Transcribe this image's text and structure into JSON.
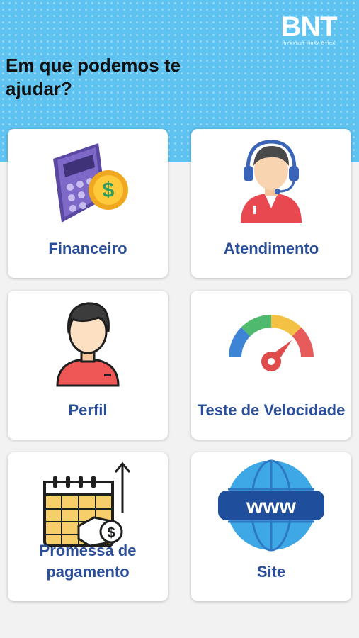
{
  "brand": {
    "logo": "BNT",
    "tagline": "INTERNET FIBRA ÓTICA"
  },
  "headline": "Em que podemos te ajudar?",
  "cards": [
    {
      "label": "Financeiro",
      "icon": "calculator-money-icon"
    },
    {
      "label": "Atendimento",
      "icon": "headset-agent-icon"
    },
    {
      "label": "Perfil",
      "icon": "user-profile-icon"
    },
    {
      "label": "Teste de Velocidade",
      "icon": "speedometer-icon"
    },
    {
      "label": "Promessa de pagamento",
      "icon": "calendar-payment-icon"
    },
    {
      "label": "Site",
      "icon": "globe-www-icon"
    }
  ],
  "colors": {
    "header_bg": "#5ec3f0",
    "label": "#2a4e9a",
    "card_bg": "#ffffff",
    "page_bg": "#f2f2f2"
  }
}
